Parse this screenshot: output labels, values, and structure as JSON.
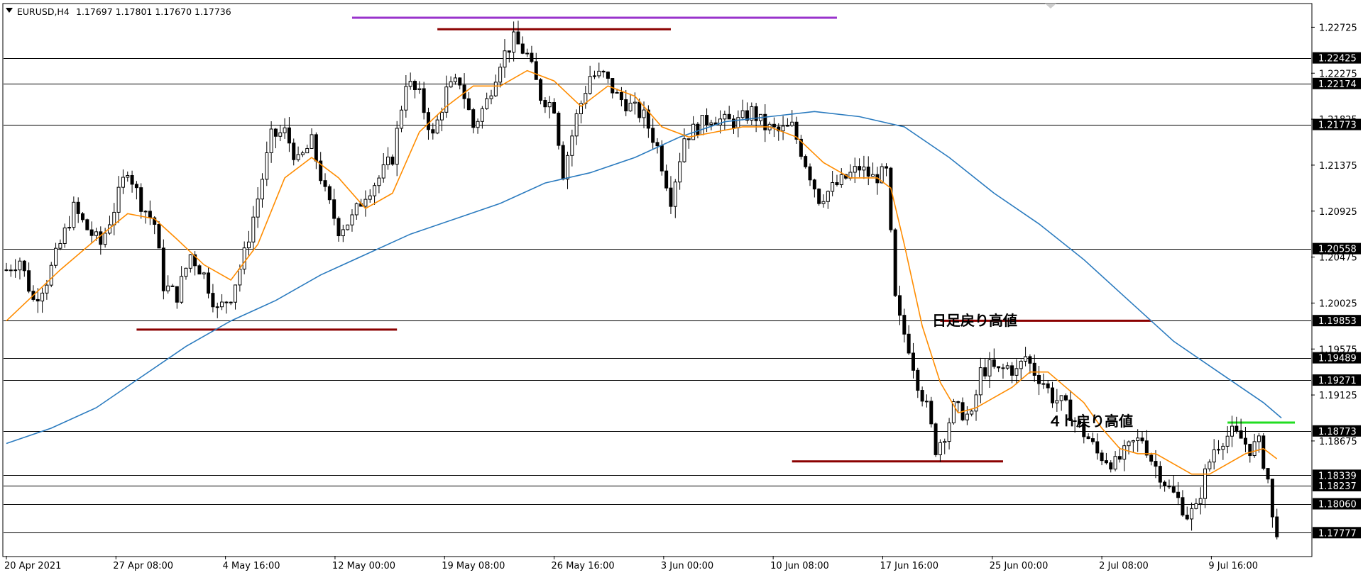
{
  "header": {
    "symbol_timeframe": "EURUSD,H4",
    "ohlc": "1.17697 1.17801 1.17670 1.17736",
    "menu_icon": "triangle-down-icon"
  },
  "colors": {
    "background": "#ffffff",
    "candle": "#000000",
    "sma_fast": "#ff8c00",
    "sma_slow": "#2b7bbf",
    "resistance_purple": "#9933cc",
    "swing_dark_red": "#8b0000",
    "green_level": "#22dd22",
    "horizontal_line": "#000000"
  },
  "annotations": {
    "daily_pullback_high": "日足戻り高値",
    "h4_pullback_high": "４ｈ戻り高値"
  },
  "chart_data": {
    "type": "candlestick",
    "symbol": "EURUSD",
    "timeframe": "H4",
    "ylim": [
      1.1755,
      1.2295
    ],
    "y_ticks": [
      1.22725,
      1.22275,
      1.21825,
      1.21375,
      1.20925,
      1.20475,
      1.20025,
      1.19575,
      1.19125,
      1.18675
    ],
    "x_ticks": [
      "20 Apr 2021",
      "27 Apr 08:00",
      "4 May 16:00",
      "12 May 00:00",
      "19 May 08:00",
      "26 May 16:00",
      "3 Jun 00:00",
      "10 Jun 08:00",
      "17 Jun 16:00",
      "25 Jun 00:00",
      "2 Jul 08:00",
      "9 Jul 16:00"
    ],
    "horizontal_levels": [
      1.22425,
      1.22174,
      1.21773,
      1.20558,
      1.19853,
      1.19489,
      1.19271,
      1.18773,
      1.18339,
      1.18237,
      1.1806,
      1.17777
    ],
    "current_price": 1.17736,
    "close_path": [
      [
        0,
        1.2035
      ],
      [
        3,
        1.2045
      ],
      [
        6,
        1.2005
      ],
      [
        9,
        1.2025
      ],
      [
        12,
        1.206
      ],
      [
        15,
        1.2095
      ],
      [
        18,
        1.2075
      ],
      [
        21,
        1.206
      ],
      [
        24,
        1.2095
      ],
      [
        27,
        1.2135
      ],
      [
        30,
        1.21
      ],
      [
        33,
        1.208
      ],
      [
        35,
        1.202
      ],
      [
        38,
        1.201
      ],
      [
        41,
        1.205
      ],
      [
        44,
        1.203
      ],
      [
        47,
        1.1995
      ],
      [
        50,
        1.201
      ],
      [
        53,
        1.205
      ],
      [
        56,
        1.2105
      ],
      [
        59,
        1.2165
      ],
      [
        62,
        1.217
      ],
      [
        65,
        1.214
      ],
      [
        68,
        1.216
      ],
      [
        71,
        1.211
      ],
      [
        74,
        1.2075
      ],
      [
        77,
        1.2085
      ],
      [
        80,
        1.211
      ],
      [
        83,
        1.2125
      ],
      [
        86,
        1.2145
      ],
      [
        89,
        1.222
      ],
      [
        92,
        1.2205
      ],
      [
        95,
        1.2165
      ],
      [
        98,
        1.221
      ],
      [
        101,
        1.222
      ],
      [
        104,
        1.2175
      ],
      [
        107,
        1.22
      ],
      [
        110,
        1.224
      ],
      [
        113,
        1.226
      ],
      [
        116,
        1.2245
      ],
      [
        119,
        1.2205
      ],
      [
        122,
        1.2195
      ],
      [
        124,
        1.213
      ],
      [
        127,
        1.2185
      ],
      [
        130,
        1.2225
      ],
      [
        133,
        1.2225
      ],
      [
        136,
        1.2205
      ],
      [
        139,
        1.2195
      ],
      [
        142,
        1.2185
      ],
      [
        145,
        1.2155
      ],
      [
        148,
        1.2105
      ],
      [
        151,
        1.2165
      ],
      [
        154,
        1.2175
      ],
      [
        157,
        1.2185
      ],
      [
        160,
        1.218
      ],
      [
        163,
        1.218
      ],
      [
        166,
        1.219
      ],
      [
        169,
        1.2175
      ],
      [
        172,
        1.217
      ],
      [
        175,
        1.2175
      ],
      [
        178,
        1.214
      ],
      [
        181,
        1.2105
      ],
      [
        184,
        1.2115
      ],
      [
        187,
        1.2125
      ],
      [
        190,
        1.2135
      ],
      [
        193,
        1.2125
      ],
      [
        196,
        1.213
      ],
      [
        198,
        1.2005
      ],
      [
        199,
        1.1985
      ],
      [
        201,
        1.196
      ],
      [
        203,
        1.1925
      ],
      [
        205,
        1.19
      ],
      [
        207,
        1.186
      ],
      [
        209,
        1.1875
      ],
      [
        211,
        1.19
      ],
      [
        213,
        1.1895
      ],
      [
        215,
        1.189
      ],
      [
        217,
        1.1935
      ],
      [
        219,
        1.194
      ],
      [
        221,
        1.1935
      ],
      [
        223,
        1.194
      ],
      [
        225,
        1.1935
      ],
      [
        227,
        1.195
      ],
      [
        229,
        1.1935
      ],
      [
        231,
        1.1925
      ],
      [
        233,
        1.191
      ],
      [
        235,
        1.1905
      ],
      [
        237,
        1.1895
      ],
      [
        239,
        1.188
      ],
      [
        241,
        1.187
      ],
      [
        243,
        1.1855
      ],
      [
        245,
        1.185
      ],
      [
        247,
        1.1845
      ],
      [
        249,
        1.1855
      ],
      [
        251,
        1.1865
      ],
      [
        253,
        1.187
      ],
      [
        255,
        1.185
      ],
      [
        257,
        1.1835
      ],
      [
        259,
        1.182
      ],
      [
        261,
        1.181
      ],
      [
        263,
        1.1795
      ],
      [
        265,
        1.18
      ],
      [
        267,
        1.1835
      ],
      [
        269,
        1.186
      ],
      [
        271,
        1.187
      ],
      [
        273,
        1.1875
      ],
      [
        275,
        1.187
      ],
      [
        277,
        1.186
      ],
      [
        279,
        1.1865
      ],
      [
        281,
        1.183
      ],
      [
        282,
        1.179
      ],
      [
        283,
        1.1777
      ]
    ],
    "sma_fast_path": [
      [
        0,
        1.1985
      ],
      [
        6,
        1.201
      ],
      [
        12,
        1.2035
      ],
      [
        20,
        1.2065
      ],
      [
        27,
        1.209
      ],
      [
        33,
        1.2085
      ],
      [
        38,
        1.2065
      ],
      [
        44,
        1.204
      ],
      [
        50,
        1.2025
      ],
      [
        56,
        1.206
      ],
      [
        62,
        1.2125
      ],
      [
        68,
        1.2145
      ],
      [
        74,
        1.2125
      ],
      [
        80,
        1.2095
      ],
      [
        86,
        1.211
      ],
      [
        92,
        1.217
      ],
      [
        98,
        1.2195
      ],
      [
        104,
        1.2215
      ],
      [
        110,
        1.2215
      ],
      [
        116,
        1.223
      ],
      [
        122,
        1.222
      ],
      [
        128,
        1.2195
      ],
      [
        134,
        1.2215
      ],
      [
        140,
        1.2205
      ],
      [
        146,
        1.2175
      ],
      [
        152,
        1.2165
      ],
      [
        158,
        1.217
      ],
      [
        164,
        1.2175
      ],
      [
        170,
        1.2175
      ],
      [
        176,
        1.2165
      ],
      [
        182,
        1.214
      ],
      [
        188,
        1.2125
      ],
      [
        194,
        1.2125
      ],
      [
        197,
        1.2115
      ],
      [
        200,
        1.206
      ],
      [
        204,
        1.198
      ],
      [
        208,
        1.1925
      ],
      [
        212,
        1.1895
      ],
      [
        216,
        1.19
      ],
      [
        220,
        1.191
      ],
      [
        224,
        1.192
      ],
      [
        228,
        1.1935
      ],
      [
        232,
        1.1935
      ],
      [
        236,
        1.192
      ],
      [
        240,
        1.1905
      ],
      [
        244,
        1.188
      ],
      [
        248,
        1.186
      ],
      [
        252,
        1.1855
      ],
      [
        256,
        1.1855
      ],
      [
        260,
        1.1845
      ],
      [
        264,
        1.1835
      ],
      [
        268,
        1.1835
      ],
      [
        272,
        1.1845
      ],
      [
        276,
        1.1855
      ],
      [
        280,
        1.186
      ],
      [
        283,
        1.185
      ]
    ],
    "sma_slow_path": [
      [
        0,
        1.1865
      ],
      [
        10,
        1.188
      ],
      [
        20,
        1.19
      ],
      [
        30,
        1.193
      ],
      [
        40,
        1.196
      ],
      [
        50,
        1.1985
      ],
      [
        60,
        1.2005
      ],
      [
        70,
        1.203
      ],
      [
        80,
        1.205
      ],
      [
        90,
        1.207
      ],
      [
        100,
        1.2085
      ],
      [
        110,
        1.21
      ],
      [
        120,
        1.212
      ],
      [
        130,
        1.213
      ],
      [
        140,
        1.2145
      ],
      [
        150,
        1.2165
      ],
      [
        160,
        1.218
      ],
      [
        170,
        1.2185
      ],
      [
        180,
        1.219
      ],
      [
        190,
        1.2185
      ],
      [
        200,
        1.2175
      ],
      [
        210,
        1.2145
      ],
      [
        220,
        1.211
      ],
      [
        230,
        1.208
      ],
      [
        240,
        1.2045
      ],
      [
        250,
        1.2005
      ],
      [
        260,
        1.1965
      ],
      [
        270,
        1.1935
      ],
      [
        280,
        1.1905
      ],
      [
        284,
        1.189
      ]
    ],
    "segments": [
      {
        "name": "top-purple-resistance",
        "from": 77,
        "to": 185,
        "price": 1.22818,
        "color": "purple"
      },
      {
        "name": "top-dark-red-swing",
        "from": 96,
        "to": 148,
        "price": 1.22705,
        "color": "dark-red"
      },
      {
        "name": "low-dark-red-swing",
        "from": 29,
        "to": 87,
        "price": 1.19765,
        "color": "dark-red"
      },
      {
        "name": "daily-pullback-high-line",
        "from": 208,
        "to": 255,
        "price": 1.19852,
        "color": "dark-red"
      },
      {
        "name": "bottom-dark-red-swing",
        "from": 175,
        "to": 222,
        "price": 1.18475,
        "color": "dark-red"
      },
      {
        "name": "h4-pullback-high-line",
        "from": 272,
        "to": 287,
        "price": 1.18855,
        "color": "green"
      }
    ]
  }
}
